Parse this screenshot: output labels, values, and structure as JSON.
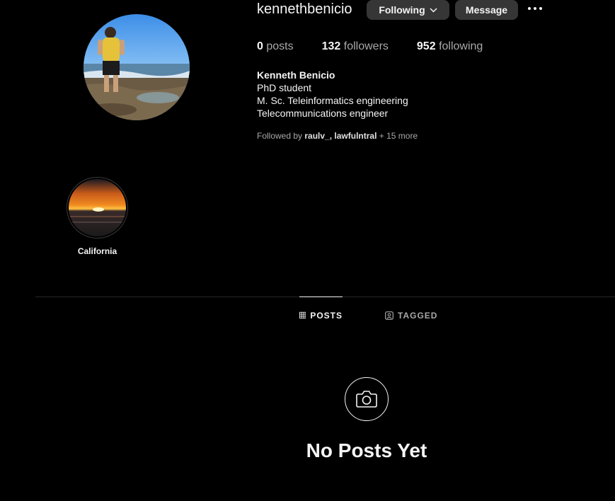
{
  "profile": {
    "username": "kennethbenicio",
    "following_button": "Following",
    "message_button": "Message",
    "more_icon": "more-horizontal-icon"
  },
  "stats": {
    "posts_count": "0",
    "posts_label": "posts",
    "followers_count": "132",
    "followers_label": "followers",
    "following_count": "952",
    "following_label": "following"
  },
  "bio": {
    "name": "Kenneth Benicio",
    "lines": [
      "PhD student",
      "M. Sc. Teleinformatics engineering",
      "Telecommunications engineer"
    ]
  },
  "followed_by": {
    "prefix": "Followed by",
    "users": "raulv_, lawfulntral",
    "more": "+ 15 more"
  },
  "highlights": [
    {
      "label": "California"
    }
  ],
  "tabs": [
    {
      "label": "POSTS",
      "icon": "grid-icon",
      "active": true
    },
    {
      "label": "TAGGED",
      "icon": "tagged-icon",
      "active": false
    }
  ],
  "empty_state": {
    "icon": "camera-icon",
    "title": "No Posts Yet"
  },
  "colors": {
    "background": "#000000",
    "button": "#363636",
    "text_primary": "#f5f5f5",
    "text_secondary": "#a8a8a8"
  }
}
